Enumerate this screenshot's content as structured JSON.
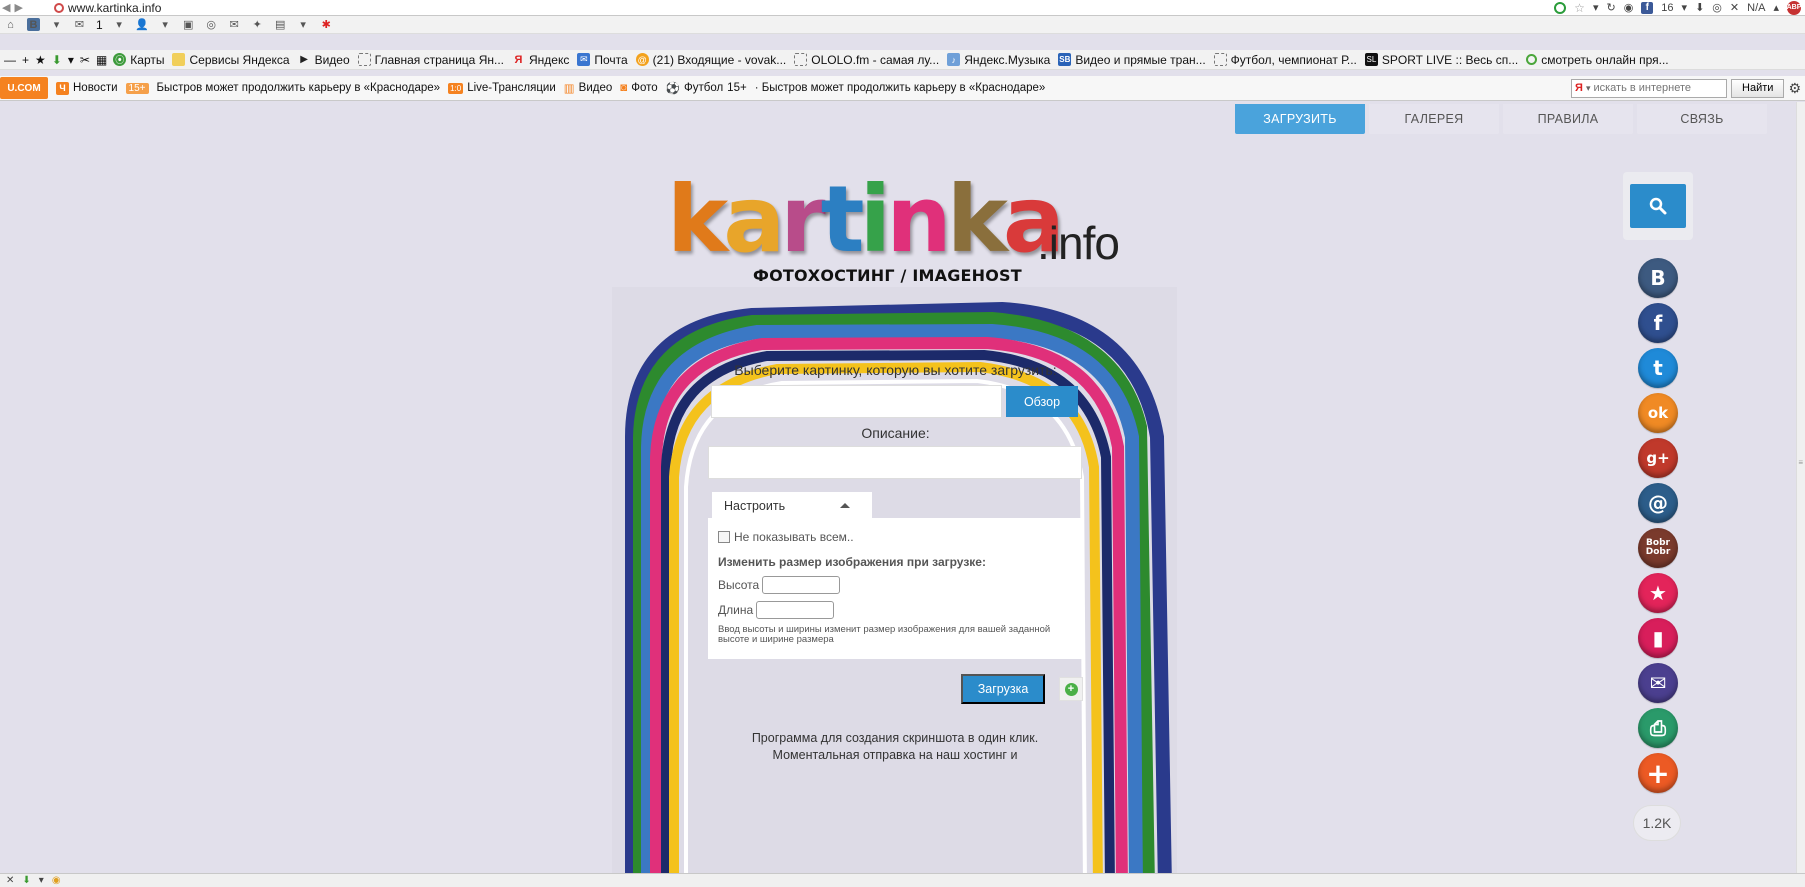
{
  "browser": {
    "url": "www.kartinka.info",
    "fb_count": "16",
    "weather": "N/A"
  },
  "toolbar": {
    "mail_count": "1"
  },
  "bookmarks": [
    {
      "label": "Карты",
      "icon": "maps-icon"
    },
    {
      "label": "Сервисы Яндекса",
      "icon": "folder-icon"
    },
    {
      "label": "Видео",
      "icon": "play-icon"
    },
    {
      "label": "Главная страница Ян...",
      "icon": "dashed-page-icon"
    },
    {
      "label": "Яндекс",
      "icon": "yandex-icon"
    },
    {
      "label": "Почта",
      "icon": "mail-icon"
    },
    {
      "label": "(21) Входящие - vovak...",
      "icon": "at-icon"
    },
    {
      "label": "OLOLO.fm - самая лу...",
      "icon": "dashed-page-icon"
    },
    {
      "label": "Яндекс.Музыка",
      "icon": "music-icon"
    },
    {
      "label": "Видео и прямые тран...",
      "icon": "sb-icon"
    },
    {
      "label": "Футбол, чемпионат Р...",
      "icon": "dashed-page-icon"
    },
    {
      "label": "SPORT LIVE :: Весь сп...",
      "icon": "sport-icon"
    },
    {
      "label": "смотреть онлайн пря...",
      "icon": "chat-icon"
    }
  ],
  "news_bar": {
    "logo": "U.COM",
    "news_label": "Новости",
    "age_badge": "15+",
    "headline": "Быстров может продолжить карьеру в «Краснодаре»",
    "live_badge": "1:0",
    "live_label": "Live-Трансляции",
    "video_label": "Видео",
    "photo_label": "Фото",
    "football_label": "Футбол",
    "age_badge_2": "15+",
    "headline_2": "· Быстров может продолжить карьеру в «Краснодаре»",
    "search_placeholder": "искать в интернете",
    "search_button": "Найти",
    "search_logo": "Я"
  },
  "nav": {
    "upload": "ЗАГРУЗИТЬ",
    "gallery": "ГАЛЕРЕЯ",
    "rules": "ПРАВИЛА",
    "contact": "СВЯЗЬ"
  },
  "logo": {
    "letters": [
      "k",
      "a",
      "r",
      "t",
      "i",
      "n",
      "k",
      "a"
    ],
    "colors": [
      "#e07a1a",
      "#e8a52a",
      "#b84c8a",
      "#2c7fc2",
      "#36a24a",
      "#e0307a",
      "#8a6f3c",
      "#d93a3a"
    ],
    "suffix": ".info",
    "subtitle": "ФОТОХОСТИНГ / IMAGEHOST"
  },
  "upload_form": {
    "choose_label": "Выберите картинку, которую вы хотите загрузить:",
    "browse_button": "Обзор",
    "description_label": "Описание:",
    "settings_tab": "Настроить",
    "hide_checkbox": "Не показывать всем..",
    "resize_label": "Изменить размер изображения при загрузке:",
    "height_label": "Высота",
    "width_label": "Длина",
    "hint": "Ввод высоты и ширины изменит размер изображения для вашей заданной высоте и ширине размера",
    "upload_button": "Загрузка"
  },
  "promo": {
    "line1": "Программа для создания скриншота в один клик.",
    "line2": "Моментальная отправка на наш хостинг и"
  },
  "share": {
    "count": "1.2K",
    "buttons": [
      {
        "name": "vk",
        "glyph": "B",
        "color": "#3d5a80"
      },
      {
        "name": "facebook",
        "glyph": "f",
        "color": "#2f4f8f"
      },
      {
        "name": "twitter",
        "glyph": "t",
        "color": "#1f8ad8"
      },
      {
        "name": "odnoklassniki",
        "glyph": "ok",
        "color": "#f08a24"
      },
      {
        "name": "google-plus",
        "glyph": "g+",
        "color": "#c0392b"
      },
      {
        "name": "mail-ru",
        "glyph": "@",
        "color": "#2c5d8a"
      },
      {
        "name": "bobrdobr",
        "glyph": "Bobr Dobr",
        "color": "#7a3a2c"
      },
      {
        "name": "favorites",
        "glyph": "★",
        "color": "#e3245a"
      },
      {
        "name": "bookmark",
        "glyph": "▮",
        "color": "#d81e5b"
      },
      {
        "name": "email",
        "glyph": "✉",
        "color": "#4b3f8f"
      },
      {
        "name": "print",
        "glyph": "⎙",
        "color": "#2a9a6a"
      },
      {
        "name": "more",
        "glyph": "+",
        "color": "#ec5a24"
      }
    ]
  }
}
